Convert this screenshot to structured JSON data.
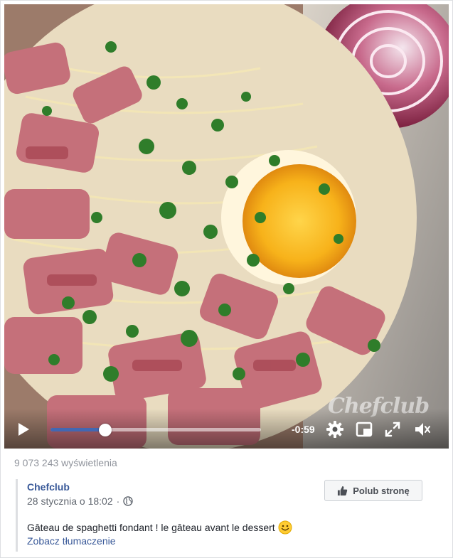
{
  "video": {
    "watermark": "Chefclub",
    "time_remaining": "-0:59",
    "progress_fraction": 0.26,
    "icons": [
      "play-icon",
      "settings-gear-icon",
      "picture-in-picture-icon",
      "fullscreen-icon",
      "volume-muted-icon"
    ]
  },
  "meta": {
    "views": "9 073 243 wyświetlenia"
  },
  "post": {
    "author": "Chefclub",
    "date": "28 stycznia o 18:02",
    "separator": "·",
    "audience_icon": "globe-icon",
    "like_page_label": "Polub stronę",
    "caption": "Gâteau de spaghetti fondant ! le gâteau avant le dessert",
    "emoji": "smiley-emoji",
    "translate_link": "Zobacz tłumaczenie"
  },
  "colors": {
    "link": "#385898",
    "progress": "#4267b2",
    "muted_text": "#90949c"
  }
}
